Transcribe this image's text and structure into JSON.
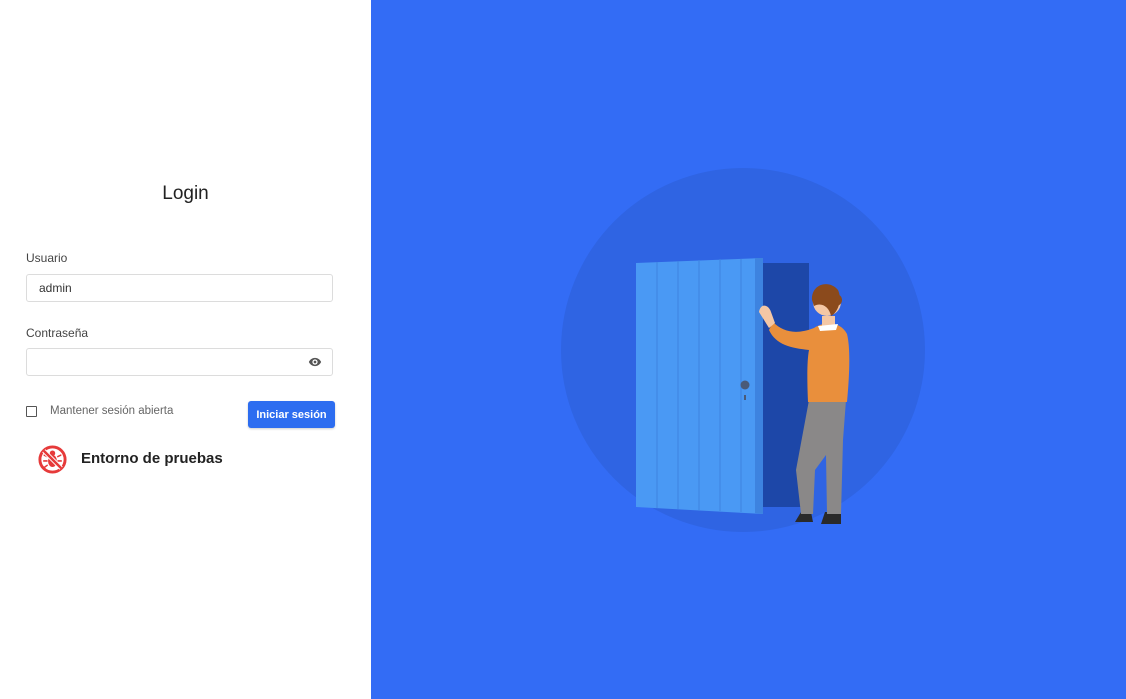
{
  "login": {
    "title": "Login",
    "username_label": "Usuario",
    "username_value": "admin",
    "password_label": "Contraseña",
    "password_value": "",
    "remember_label": "Mantener sesión abierta",
    "remember_checked": false,
    "submit_label": "Iniciar sesión"
  },
  "environment": {
    "label": "Entorno de pruebas",
    "icon": "no-bug-icon"
  },
  "illustration": {
    "icon": "person-opening-door-illustration"
  },
  "colors": {
    "accent": "#336cf5",
    "button": "#2d6df0",
    "environment_icon": "#e63a3a"
  }
}
